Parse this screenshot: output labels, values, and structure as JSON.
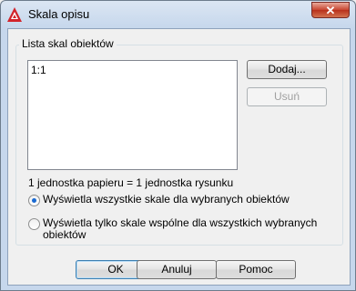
{
  "window": {
    "title": "Skala opisu",
    "close_glyph": "✕"
  },
  "group": {
    "label": "Lista skal obiektów",
    "items": [
      "1:1"
    ]
  },
  "buttons": {
    "add": "Dodaj...",
    "remove": "Usuń",
    "ok": "OK",
    "cancel": "Anuluj",
    "help": "Pomoc"
  },
  "info": "1 jednostka papieru = 1 jednostka rysunku",
  "radios": [
    {
      "label": "Wyświetla wszystkie skale dla wybranych obiektów",
      "checked": true
    },
    {
      "label_line1": "Wyświetla tylko skale wspólne dla wszystkich wybranych",
      "label_line2": "obiektów",
      "checked": false
    }
  ],
  "icons": {
    "app": "autocad-icon",
    "close": "close-icon"
  },
  "colors": {
    "accent": "#1a6ad2",
    "close_red": "#c7442f",
    "app_red": "#d2232a"
  }
}
